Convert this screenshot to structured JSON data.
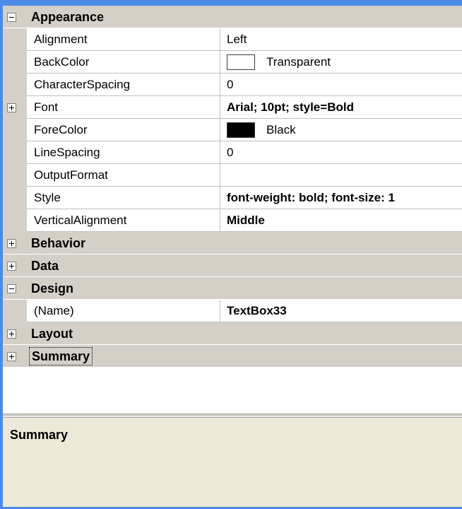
{
  "categories": {
    "appearance": {
      "label": "Appearance",
      "expanded": true,
      "properties": [
        {
          "name": "Alignment",
          "value": "Left"
        },
        {
          "name": "BackColor",
          "value": "Transparent",
          "swatch": "#ffffff"
        },
        {
          "name": "CharacterSpacing",
          "value": "0"
        },
        {
          "name": "Font",
          "value": "Arial; 10pt; style=Bold",
          "expandable": true
        },
        {
          "name": "ForeColor",
          "value": "Black",
          "swatch": "#000000"
        },
        {
          "name": "LineSpacing",
          "value": "0"
        },
        {
          "name": "OutputFormat",
          "value": ""
        },
        {
          "name": "Style",
          "value": "font-weight: bold; font-size: 1"
        },
        {
          "name": "VerticalAlignment",
          "value": "Middle"
        }
      ]
    },
    "behavior": {
      "label": "Behavior",
      "expanded": false
    },
    "data": {
      "label": "Data",
      "expanded": false
    },
    "design": {
      "label": "Design",
      "expanded": true,
      "properties": [
        {
          "name": "(Name)",
          "value": "TextBox33"
        }
      ]
    },
    "layout": {
      "label": "Layout",
      "expanded": false
    },
    "summary": {
      "label": "Summary",
      "expanded": false
    }
  },
  "description": {
    "title": "Summary"
  },
  "colors": {
    "window_border": "#4a8ae8",
    "gutter": "#d4d0c8",
    "description_panel": "#ece9d8"
  }
}
